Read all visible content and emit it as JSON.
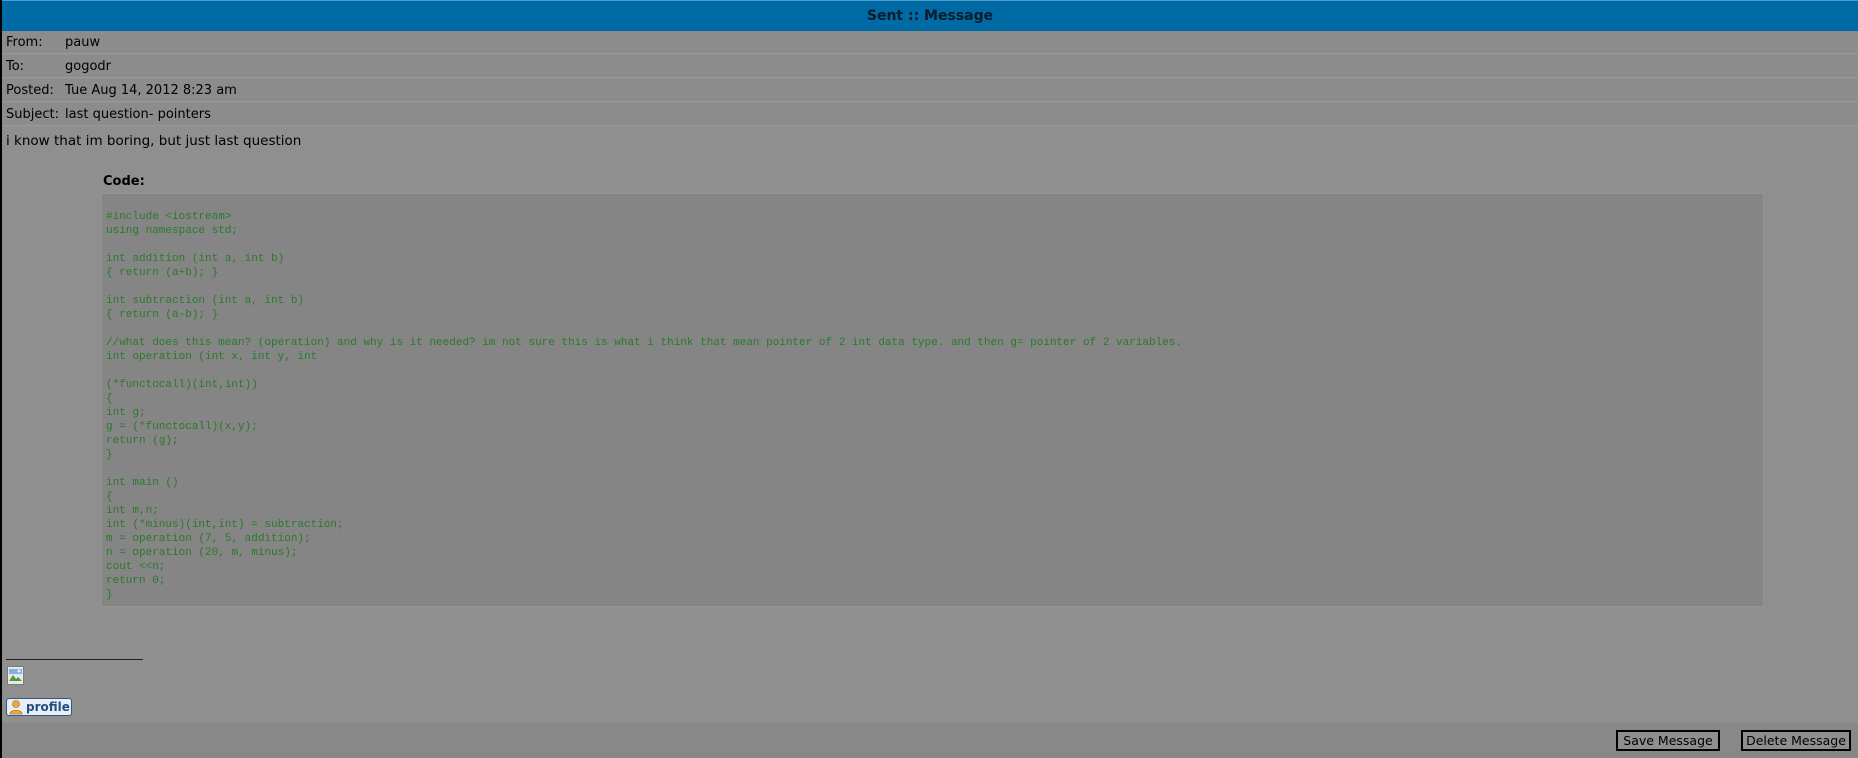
{
  "header": {
    "title": "Sent :: Message"
  },
  "meta": [
    {
      "label": "From:",
      "value": "pauw"
    },
    {
      "label": "To:",
      "value": "gogodr"
    },
    {
      "label": "Posted:",
      "value": "Tue Aug 14, 2012 8:23 am"
    },
    {
      "label": "Subject:",
      "value": "last question- pointers"
    }
  ],
  "message": {
    "body": "i know that im boring, but just last question",
    "code_label": "Code:",
    "code": "#include <iostream>\nusing namespace std;\n\nint addition (int a, int b)\n{ return (a+b); }\n\nint subtraction (int a, int b)\n{ return (a-b); }\n\n//what does this mean? (operation) and why is it needed? im not sure this is what i think that mean pointer of 2 int data type. and then g= pointer of 2 variables.\nint operation (int x, int y, int\n\n(*functocall)(int,int))\n{\nint g;\ng = (*functocall)(x,y);\nreturn (g);\n}\n\nint main ()\n{\nint m,n;\nint (*minus)(int,int) = subtraction;\nm = operation (7, 5, addition);\nn = operation (20, m, minus);\ncout <<n;\nreturn 0;\n}"
  },
  "signature": {
    "image_icon": "broken-image-icon",
    "profile_label": "profile",
    "profile_icon": "user-icon"
  },
  "actions": {
    "save_label": "Save Message",
    "delete_label": "Delete Message"
  }
}
